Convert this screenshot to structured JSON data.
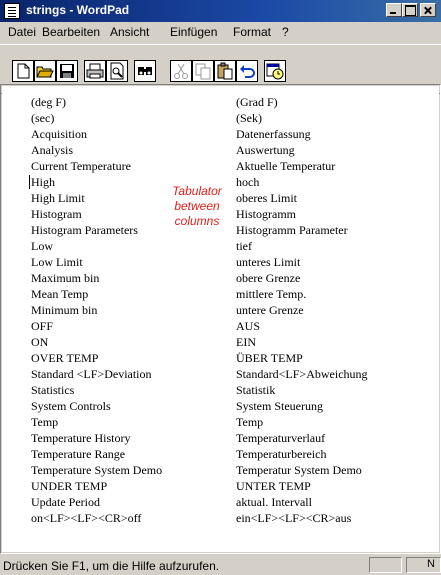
{
  "window": {
    "title": "strings - WordPad"
  },
  "menu": [
    "Datei",
    "Bearbeiten",
    "Ansicht",
    "Einfügen",
    "Format",
    "?"
  ],
  "annotation": [
    "Tabulator",
    "between",
    "columns"
  ],
  "rows": [
    [
      "(deg F)",
      "(Grad F)"
    ],
    [
      "(sec)",
      "(Sek)"
    ],
    [
      "Acquisition",
      "Datenerfassung"
    ],
    [
      "Analysis",
      "Auswertung"
    ],
    [
      "Current Temperature",
      "Aktuelle Temperatur"
    ],
    [
      "High",
      "hoch"
    ],
    [
      "High Limit",
      "oberes Limit"
    ],
    [
      "Histogram",
      "Histogramm"
    ],
    [
      "Histogram Parameters",
      "Histogramm Parameter"
    ],
    [
      "Low",
      "tief"
    ],
    [
      "Low Limit",
      "unteres Limit"
    ],
    [
      "Maximum bin",
      "obere Grenze"
    ],
    [
      "Mean Temp",
      "mittlere Temp."
    ],
    [
      "Minimum bin",
      "untere Grenze"
    ],
    [
      "OFF",
      "AUS"
    ],
    [
      "ON",
      "EIN"
    ],
    [
      "OVER TEMP",
      "ÜBER TEMP"
    ],
    [
      "Standard <LF>Deviation",
      "Standard<LF>Abweichung"
    ],
    [
      "Statistics",
      "Statistik"
    ],
    [
      "System Controls",
      "System Steuerung"
    ],
    [
      "Temp",
      "Temp"
    ],
    [
      "Temperature History",
      "Temperaturverlauf"
    ],
    [
      "Temperature Range",
      "Temperaturbereich"
    ],
    [
      "Temperature System Demo",
      "Temperatur System Demo"
    ],
    [
      "UNDER TEMP",
      "UNTER TEMP"
    ],
    [
      "Update Period",
      "aktual. Intervall"
    ],
    [
      "on<LF><LF><CR>off",
      "ein<LF><LF><CR>aus"
    ]
  ],
  "status": {
    "text": "Drücken Sie F1, um die Hilfe aufzurufen."
  },
  "toolbar": [
    "new-icon",
    "open-icon",
    "save-icon",
    "print-icon",
    "print-preview-icon",
    "find-icon",
    "cut-icon",
    "copy-icon",
    "paste-icon",
    "undo-icon",
    "date-time-icon"
  ]
}
